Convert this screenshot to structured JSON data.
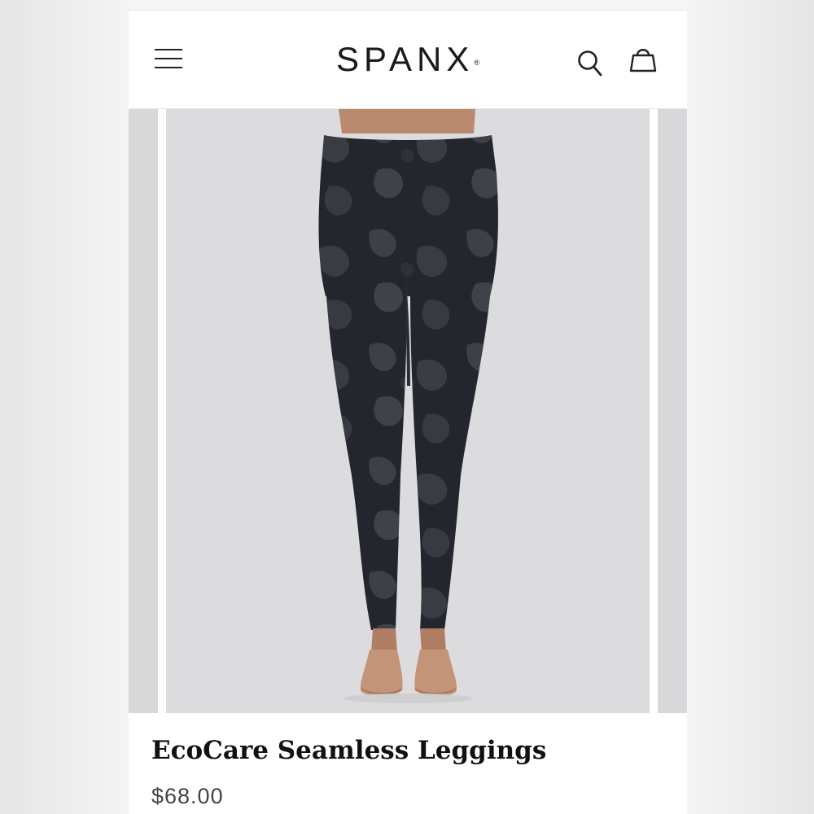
{
  "header": {
    "brand": "SPANX",
    "brand_mark": "®",
    "icons": [
      "hamburger-menu-icon",
      "search-icon",
      "shopping-bag-icon"
    ]
  },
  "product": {
    "title": "EcoCare Seamless Leggings",
    "price": "$68.00",
    "image_subject": "black camo leggings"
  },
  "colors": {
    "background": "#ececec",
    "header_bg": "#ffffff",
    "slide_bg": "#dcdcde",
    "leggings_dark": "#23262c",
    "leggings_camo": "#3d4046",
    "text_primary": "#111111",
    "text_price": "#444444"
  }
}
